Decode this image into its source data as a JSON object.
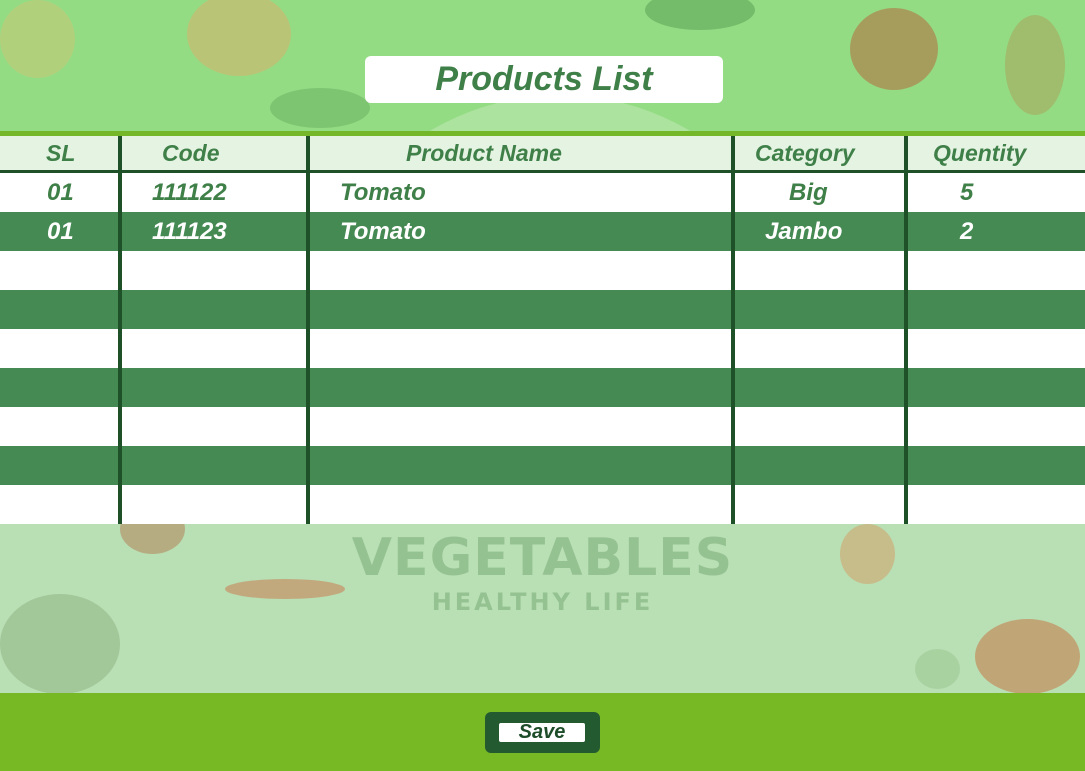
{
  "page": {
    "title": "Products List",
    "save_label": "Save"
  },
  "watermark": {
    "brand": "VEGETABLES",
    "tagline": "HEALTHY LIFE"
  },
  "colors": {
    "background_green": "#94d98a",
    "title_text": "#3f7f48",
    "row_dark": "#458953",
    "grid_lines": "#1f5128",
    "footer_bar": "#77b825",
    "save_button": "#245a30"
  },
  "table": {
    "columns": [
      "SL",
      "Code",
      "Product Name",
      "Category",
      "Quentity"
    ],
    "rows": [
      [
        "01",
        "111122",
        "Tomato",
        "Big",
        "5"
      ],
      [
        "01",
        "111123",
        "Tomato",
        "Jambo",
        "2"
      ],
      [
        "",
        "",
        "",
        "",
        ""
      ],
      [
        "",
        "",
        "",
        "",
        ""
      ],
      [
        "",
        "",
        "",
        "",
        ""
      ],
      [
        "",
        "",
        "",
        "",
        ""
      ],
      [
        "",
        "",
        "",
        "",
        ""
      ],
      [
        "",
        "",
        "",
        "",
        ""
      ],
      [
        "",
        "",
        "",
        "",
        ""
      ]
    ]
  }
}
